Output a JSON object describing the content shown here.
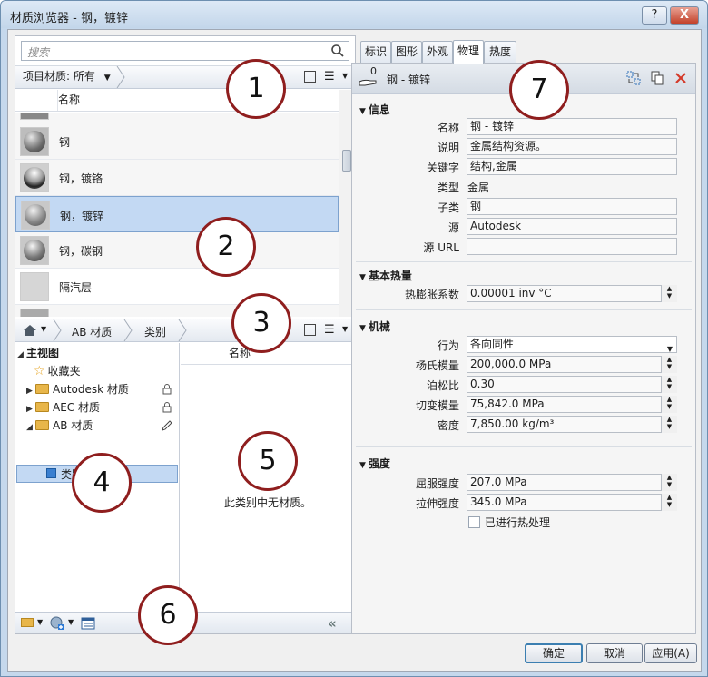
{
  "window": {
    "title": "材质浏览器 - 钢，镀锌",
    "help_label": "?",
    "close_label": "X"
  },
  "search": {
    "placeholder": "搜索"
  },
  "library_bar": {
    "filter_label": "项目材质: 所有"
  },
  "material_list": {
    "column_header": "名称",
    "items": [
      {
        "label": "钢",
        "thumb": "steel-sphere"
      },
      {
        "label": "钢，镀铬",
        "thumb": "chrome-sphere"
      },
      {
        "label": "钢，镀锌",
        "thumb": "galvanized-sphere",
        "selected": true
      },
      {
        "label": "钢，碳钢",
        "thumb": "carbon-steel-sphere"
      },
      {
        "label": "隔汽层",
        "thumb": "flat-gray-swatch"
      }
    ]
  },
  "library_breadcrumb": {
    "home_icon": "home-icon",
    "items": [
      "AB 材质",
      "类别"
    ]
  },
  "tree": {
    "root": "主视图",
    "favorites": "收藏夹",
    "libraries": [
      {
        "label": "Autodesk 材质",
        "icon": "lock-icon"
      },
      {
        "label": "AEC 材质",
        "icon": "lock-icon"
      },
      {
        "label": "AB 材质",
        "icon": "pencil-icon",
        "expanded": true
      }
    ],
    "selected_child": "类别"
  },
  "category_pane": {
    "column_header": "名称",
    "empty_message": "此类别中无材质。"
  },
  "tabs": [
    "标识",
    "图形",
    "外观",
    "物理",
    "热度"
  ],
  "active_tab": "物理",
  "asset": {
    "hand_count": "0",
    "name": "钢 - 镀锌"
  },
  "sections": {
    "info": {
      "title": "信息",
      "name_label": "名称",
      "name_value": "钢 - 镀锌",
      "desc_label": "说明",
      "desc_value": "金属结构资源。",
      "keywords_label": "关键字",
      "keywords_value": "结构,金属",
      "type_label": "类型",
      "type_value": "金属",
      "subclass_label": "子类",
      "subclass_value": "钢",
      "source_label": "源",
      "source_value": "Autodesk",
      "source_url_label": "源 URL",
      "source_url_value": ""
    },
    "thermal": {
      "title": "基本热量",
      "expansion_label": "热膨胀系数",
      "expansion_value": "0.00001 inv °C"
    },
    "mechanical": {
      "title": "机械",
      "behavior_label": "行为",
      "behavior_value": "各向同性",
      "young_label": "杨氏模量",
      "young_value": "200,000.0 MPa",
      "poisson_label": "泊松比",
      "poisson_value": "0.30",
      "shear_label": "切变模量",
      "shear_value": "75,842.0 MPa",
      "density_label": "密度",
      "density_value": "7,850.00 kg/m³"
    },
    "strength": {
      "title": "强度",
      "yield_label": "屈服强度",
      "yield_value": "207.0 MPa",
      "tensile_label": "拉伸强度",
      "tensile_value": "345.0 MPa",
      "heat_label": "已进行热处理",
      "heat_checked": false
    }
  },
  "footer": {
    "ok": "确定",
    "cancel": "取消",
    "apply": "应用(A)"
  },
  "callouts": [
    "1",
    "2",
    "3",
    "4",
    "5",
    "6",
    "7"
  ]
}
